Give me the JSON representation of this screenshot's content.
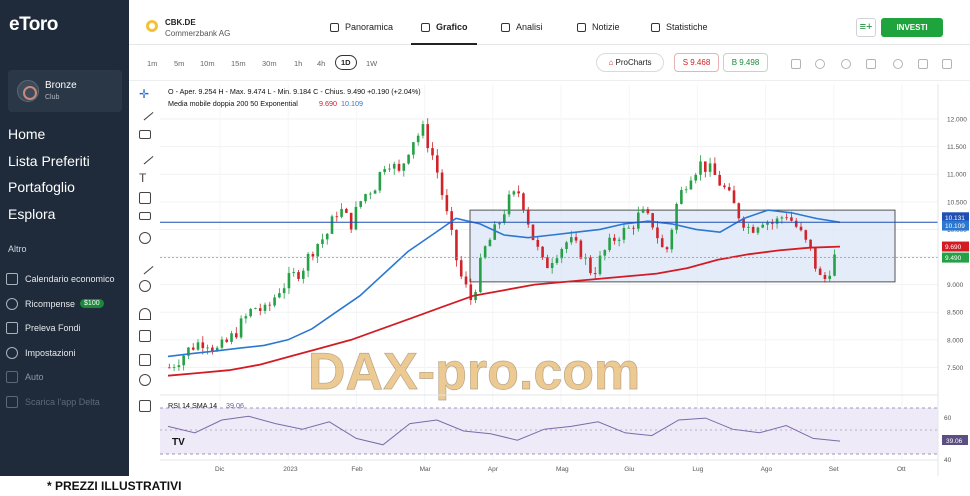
{
  "sidebar": {
    "logo": "eToro",
    "club": {
      "name": "Bronze",
      "sub": "Club"
    },
    "main_nav": [
      "Home",
      "Lista Preferiti",
      "Portafoglio",
      "Esplora"
    ],
    "section": "Altro",
    "sub_nav": [
      {
        "label": "Calendario economico",
        "icon": "calendar-icon"
      },
      {
        "label": "Ricompense",
        "icon": "gift-icon",
        "badge": "$100"
      },
      {
        "label": "Preleva Fondi",
        "icon": "withdraw-icon"
      },
      {
        "label": "Impostazioni",
        "icon": "gear-icon"
      },
      {
        "label": "Auto",
        "icon": "auto-icon"
      },
      {
        "label": "Scarica l'app Delta",
        "icon": "download-icon"
      }
    ]
  },
  "header": {
    "symbol": "CBK.DE",
    "name": "Commerzbank AG",
    "tabs": [
      {
        "label": "Panoramica",
        "icon": "overview-icon"
      },
      {
        "label": "Grafico",
        "icon": "chart-icon",
        "active": true
      },
      {
        "label": "Analisi",
        "icon": "flask-icon"
      },
      {
        "label": "Notizie",
        "icon": "news-icon"
      },
      {
        "label": "Statistiche",
        "icon": "stats-icon"
      }
    ],
    "invest_label": "INVESTI"
  },
  "toolbar": {
    "timeframes": [
      "1m",
      "5m",
      "10m",
      "15m",
      "30m",
      "1h",
      "4h",
      "1D",
      "1W"
    ],
    "active_timeframe": "1D",
    "procharts_label": "ProCharts",
    "sell_label": "S 9.468",
    "buy_label": "B 9.498"
  },
  "chart": {
    "ohlc_line": "O - Aper. 9.254  H - Max. 9.474  L - Min. 9.184  C - Chius. 9.490  +0.190 (+2.04%)",
    "ma_label": "Media mobile doppia 200 50 Exponential",
    "ma_val_red": "9.690",
    "ma_val_blue": "10.109",
    "rsi_label": "RSI 14 SMA 14",
    "rsi_value": "39.06",
    "watermark": "DAX-pro.com",
    "price_tag_blue1": "10.131",
    "price_tag_blue2": "10.109",
    "price_tag_red": "9.690",
    "price_tag_green": "9.490",
    "rsi_tag": "39.06",
    "tv_logo": "TV"
  },
  "chart_data": {
    "type": "candlestick",
    "title": "CBK.DE",
    "x_ticks": [
      "Dic",
      "2023",
      "Feb",
      "Mar",
      "Apr",
      "Mag",
      "Giu",
      "Lug",
      "Ago",
      "Set",
      "Ott"
    ],
    "y_ticks": [
      12.0,
      11.5,
      11.0,
      10.5,
      10.0,
      9.5,
      9.0,
      8.5,
      8.0,
      7.5
    ],
    "ylim": [
      7.2,
      12.2
    ],
    "close_path": [
      7.5,
      7.7,
      7.9,
      8.0,
      7.8,
      8.0,
      8.3,
      8.6,
      8.5,
      8.9,
      9.1,
      9.3,
      9.7,
      9.9,
      10.4,
      10.1,
      10.6,
      10.8,
      11.3,
      11.0,
      11.6,
      11.8,
      11.2,
      10.2,
      9.2,
      8.7,
      9.6,
      10.0,
      10.5,
      10.7,
      9.9,
      9.3,
      9.6,
      9.8,
      9.6,
      9.2,
      9.6,
      9.9,
      10.0,
      10.3,
      10.1,
      9.5,
      10.5,
      11.0,
      11.2,
      11.0,
      10.7,
      10.3,
      10.0,
      10.2,
      10.1,
      10.3,
      10.0,
      9.6,
      9.0,
      9.49
    ],
    "ema50": [
      7.7,
      7.75,
      7.8,
      7.85,
      7.9,
      8.0,
      8.2,
      8.5,
      8.8,
      9.2,
      9.6,
      9.9,
      10.2,
      10.1,
      9.9,
      9.85,
      9.9,
      9.95,
      10.0,
      10.1,
      10.15,
      10.1,
      10.0,
      9.95,
      10.2,
      10.35,
      10.3,
      10.2,
      10.13
    ],
    "ema200": [
      7.35,
      7.4,
      7.45,
      7.55,
      7.7,
      7.85,
      8.0,
      8.2,
      8.4,
      8.6,
      8.8,
      8.9,
      9.0,
      9.05,
      9.1,
      9.15,
      9.2,
      9.3,
      9.45,
      9.55,
      9.62,
      9.67,
      9.69
    ],
    "range_box": {
      "top": 10.35,
      "bottom": 9.05
    },
    "hline_blue": 10.13,
    "rsi": [
      55,
      48,
      62,
      66,
      58,
      52,
      60,
      42,
      35,
      58,
      62,
      50,
      47,
      40,
      52,
      55,
      60,
      48,
      45,
      62,
      64,
      52,
      48,
      56,
      42,
      39
    ],
    "rsi_ticks": [
      60.0,
      40.0
    ]
  },
  "footnote": "* PREZZI ILLUSTRATIVI"
}
